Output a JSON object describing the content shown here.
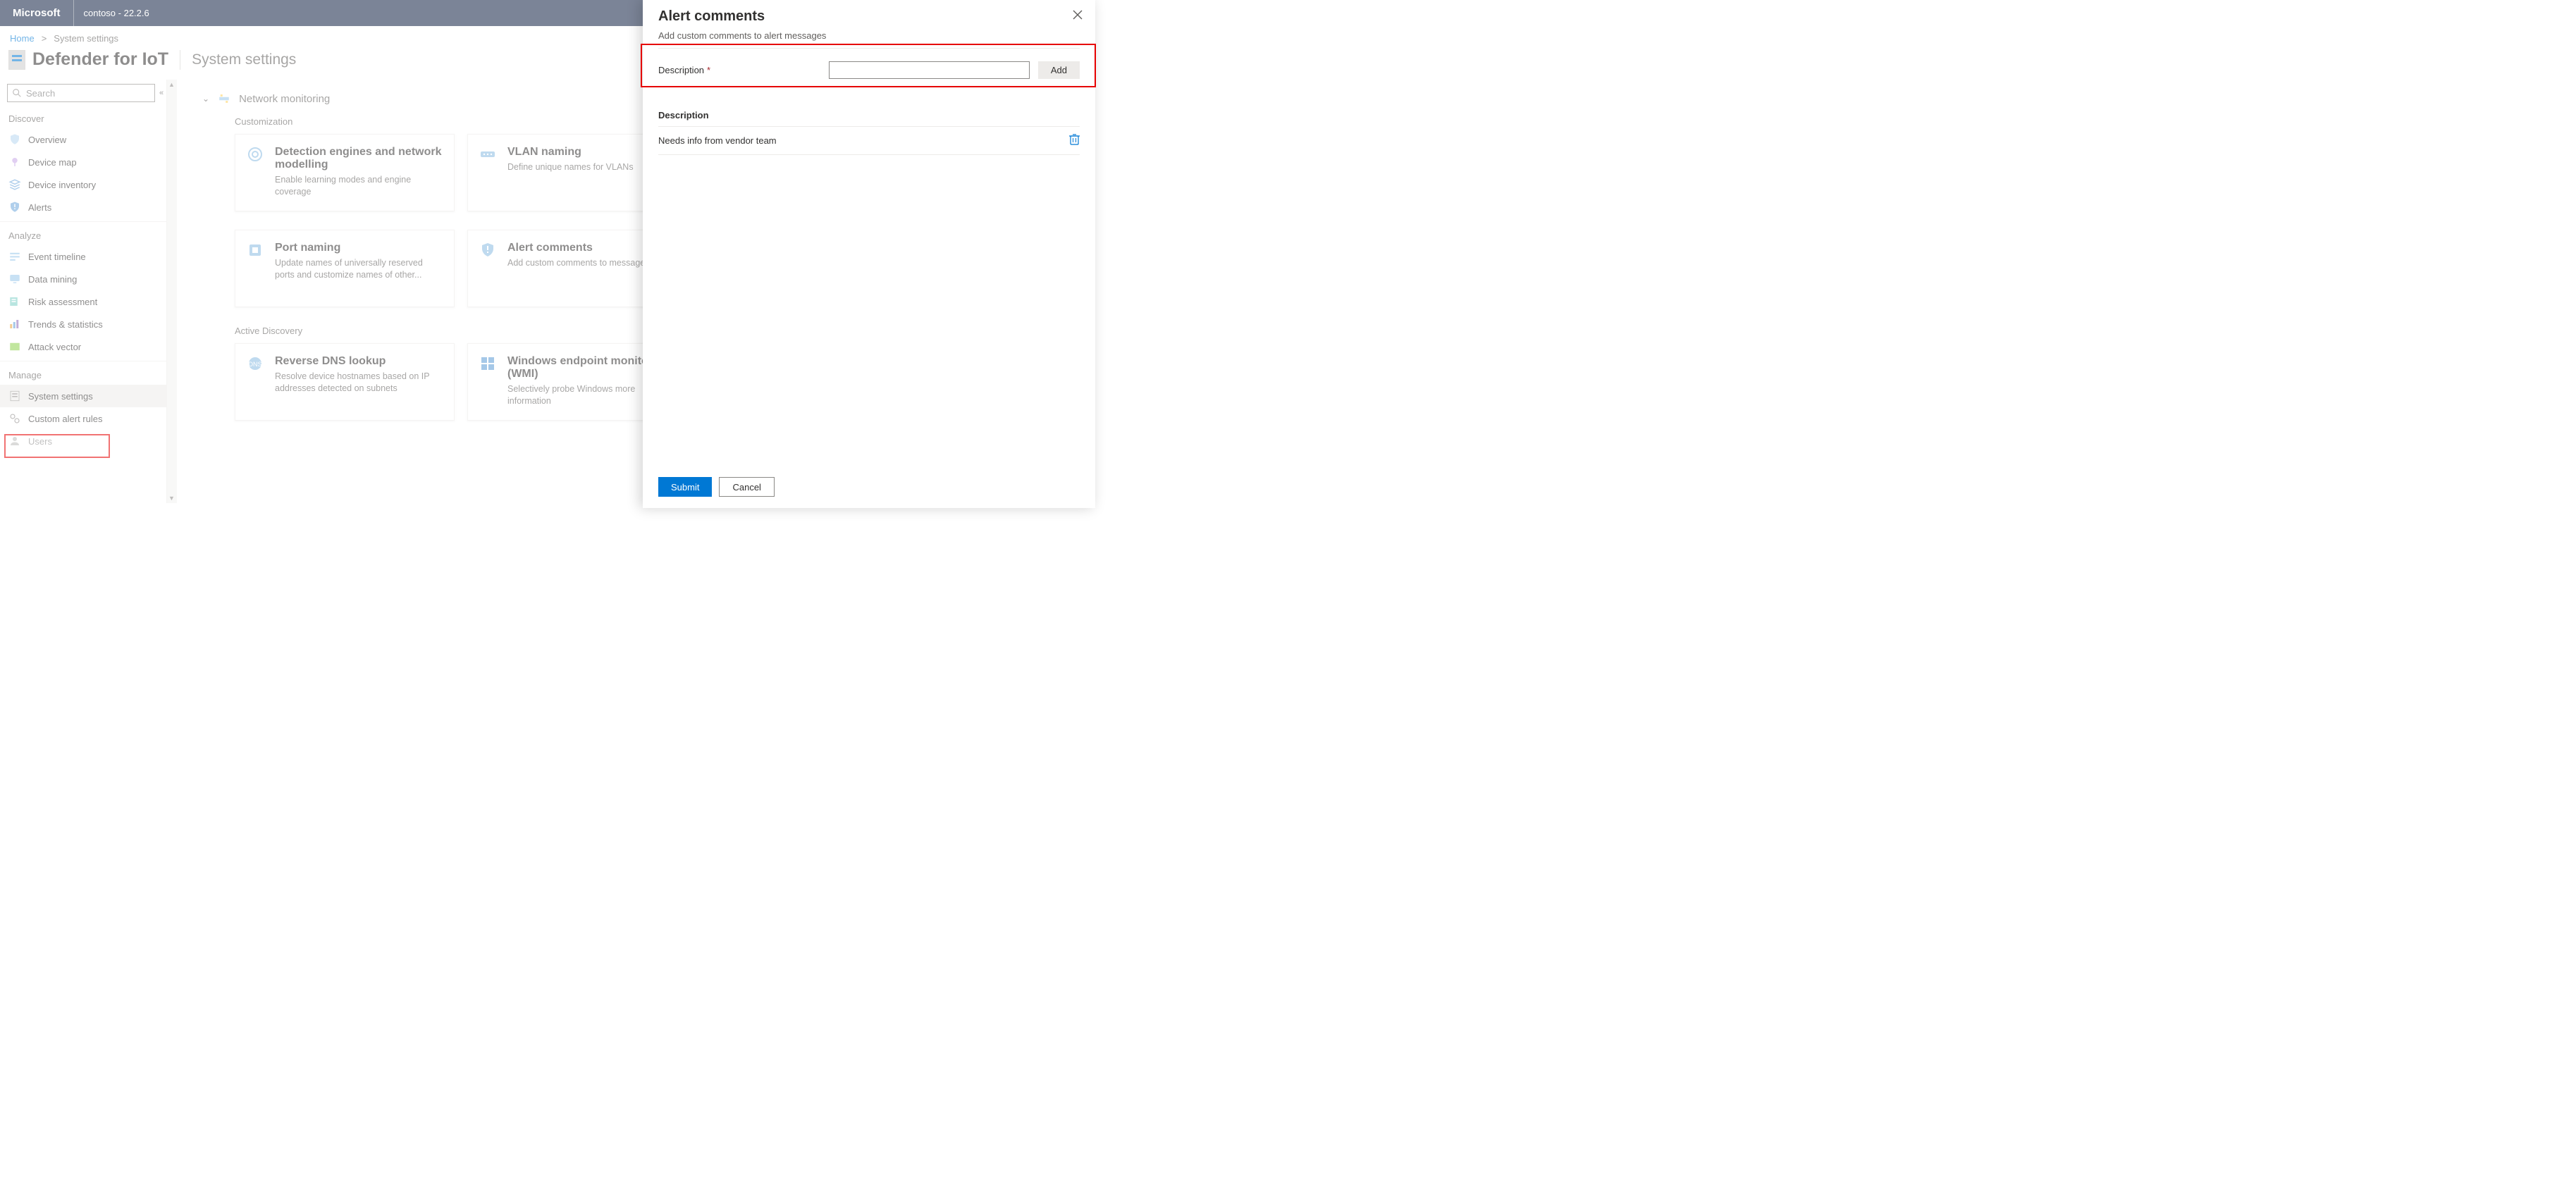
{
  "topbar": {
    "brand": "Microsoft",
    "tenant": "contoso - 22.2.6"
  },
  "breadcrumb": {
    "home": "Home",
    "sep": ">",
    "current": "System settings"
  },
  "page": {
    "title": "Defender for IoT",
    "subtitle": "System settings"
  },
  "search": {
    "placeholder": "Search",
    "collapse_glyph": "«"
  },
  "nav": {
    "sections": [
      {
        "label": "Discover",
        "items": [
          {
            "name": "overview",
            "label": "Overview"
          },
          {
            "name": "device-map",
            "label": "Device map"
          },
          {
            "name": "device-inventory",
            "label": "Device inventory"
          },
          {
            "name": "alerts",
            "label": "Alerts"
          }
        ]
      },
      {
        "label": "Analyze",
        "items": [
          {
            "name": "event-timeline",
            "label": "Event timeline"
          },
          {
            "name": "data-mining",
            "label": "Data mining"
          },
          {
            "name": "risk-assessment",
            "label": "Risk assessment"
          },
          {
            "name": "trends-statistics",
            "label": "Trends & statistics"
          },
          {
            "name": "attack-vector",
            "label": "Attack vector"
          }
        ]
      },
      {
        "label": "Manage",
        "items": [
          {
            "name": "system-settings",
            "label": "System settings",
            "active": true
          },
          {
            "name": "custom-alert-rules",
            "label": "Custom alert rules"
          },
          {
            "name": "users",
            "label": "Users"
          }
        ]
      }
    ]
  },
  "main": {
    "section_title": "Network monitoring",
    "groups": [
      {
        "label": "Customization",
        "cards": [
          {
            "name": "detection-engines",
            "title": "Detection engines and network modelling",
            "desc": "Enable learning modes and engine coverage"
          },
          {
            "name": "vlan-naming",
            "title": "VLAN naming",
            "desc": "Define unique names for VLANs"
          },
          {
            "name": "port-naming",
            "title": "Port naming",
            "desc": "Update names of universally reserved ports and customize names of other..."
          },
          {
            "name": "alert-comments",
            "title": "Alert comments",
            "desc": "Add custom comments to messages"
          }
        ]
      },
      {
        "label": "Active Discovery",
        "cards": [
          {
            "name": "reverse-dns",
            "title": "Reverse DNS lookup",
            "desc": "Resolve device hostnames based on IP addresses detected on subnets"
          },
          {
            "name": "wmi",
            "title": "Windows endpoint monitoring (WMI)",
            "desc": "Selectively probe Windows more information"
          }
        ]
      }
    ]
  },
  "panel": {
    "title": "Alert comments",
    "subtitle": "Add custom comments to alert messages",
    "form": {
      "label": "Description",
      "add_btn": "Add"
    },
    "table": {
      "header": "Description",
      "rows": [
        "Needs info from vendor team"
      ]
    },
    "footer": {
      "submit": "Submit",
      "cancel": "Cancel"
    }
  }
}
